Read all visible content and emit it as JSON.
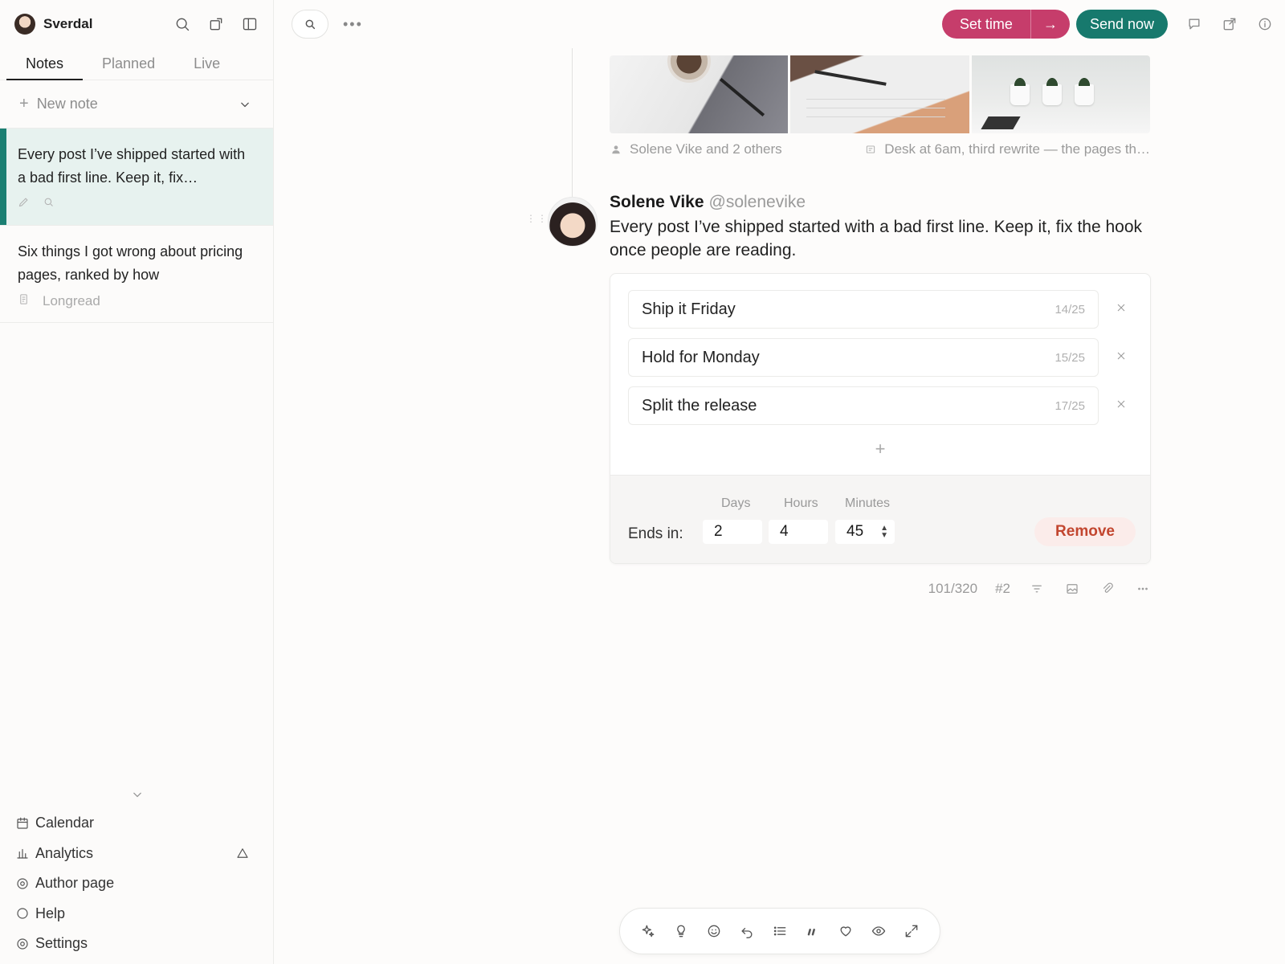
{
  "sidebar": {
    "workspace": "Sverdal",
    "tabs": [
      {
        "label": "Notes",
        "active": true
      },
      {
        "label": "Planned",
        "active": false
      },
      {
        "label": "Live",
        "active": false
      }
    ],
    "new_note": "New note",
    "notes": [
      {
        "text": "Every post I’ve shipped started with a bad first line. Keep it, fix…",
        "active": true
      },
      {
        "text": "Six things I got wrong about pricing pages, ranked by how",
        "tag": "Longread",
        "active": false
      }
    ],
    "nav": [
      {
        "label": "Calendar",
        "icon": "calendar-icon"
      },
      {
        "label": "Analytics",
        "icon": "bar-chart-icon"
      },
      {
        "label": "Author page",
        "icon": "target-icon"
      },
      {
        "label": "Help",
        "icon": "circle-icon"
      },
      {
        "label": "Settings",
        "icon": "gear-icon"
      }
    ]
  },
  "topbar": {
    "set_time": "Set time",
    "send_now": "Send now"
  },
  "thread": {
    "images_caption_people": "Solene Vike and 2 others",
    "images_caption_alt": "Desk at 6am, third rewrite — the pages th…"
  },
  "post": {
    "author": "Solene Vike",
    "handle": "@solenevike",
    "body": "Every post I’ve shipped started with a bad first line. Keep it, fix the hook once people are reading.",
    "poll": {
      "options": [
        {
          "text": "Ship it Friday",
          "count": "14/25"
        },
        {
          "text": "Hold for Monday",
          "count": "15/25"
        },
        {
          "text": "Split the release",
          "count": "17/25"
        }
      ],
      "ends_label": "Ends in:",
      "days_label": "Days",
      "hours_label": "Hours",
      "minutes_label": "Minutes",
      "days": "2",
      "hours": "4",
      "minutes": "45",
      "remove": "Remove"
    },
    "char_count": "101/320",
    "post_index": "#2"
  },
  "colors": {
    "accent_pink": "#c63d6b",
    "accent_teal": "#17796d",
    "remove_red": "#c2462f"
  }
}
